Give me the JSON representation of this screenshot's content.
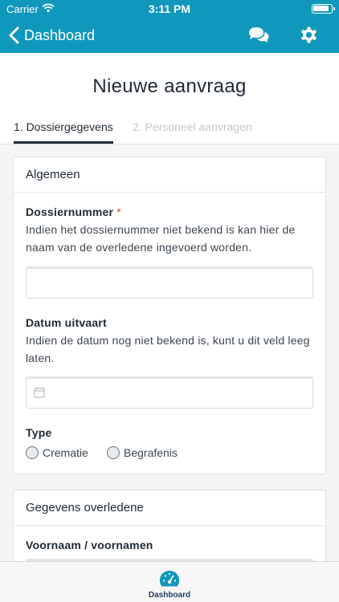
{
  "statusbar": {
    "carrier": "Carrier",
    "time": "3:11 PM"
  },
  "nav": {
    "back_label": "Dashboard"
  },
  "page": {
    "title": "Nieuwe aanvraag"
  },
  "tabs": [
    {
      "label": "1. Dossiergegevens",
      "active": true
    },
    {
      "label": "2. Personeel aanvragen",
      "active": false
    }
  ],
  "section_general": {
    "title": "Algemeen",
    "dossiernummer": {
      "label": "Dossiernummer",
      "required_mark": "*",
      "help": "Indien het dossiernummer niet bekend is kan hier de naam van de overledene ingevoerd worden.",
      "value": ""
    },
    "datum": {
      "label": "Datum uitvaart",
      "help": "Indien de datum nog niet bekend is, kunt u dit veld leeg laten.",
      "value": ""
    },
    "type": {
      "label": "Type",
      "options": [
        "Crematie",
        "Begrafenis"
      ]
    }
  },
  "section_deceased": {
    "title": "Gegevens overledene",
    "firstnames_label": "Voornaam / voornamen"
  },
  "tabbar": {
    "dashboard_label": "Dashboard"
  },
  "colors": {
    "header": "#1098bc",
    "required": "#e0463e",
    "text": "#1f2a36"
  }
}
